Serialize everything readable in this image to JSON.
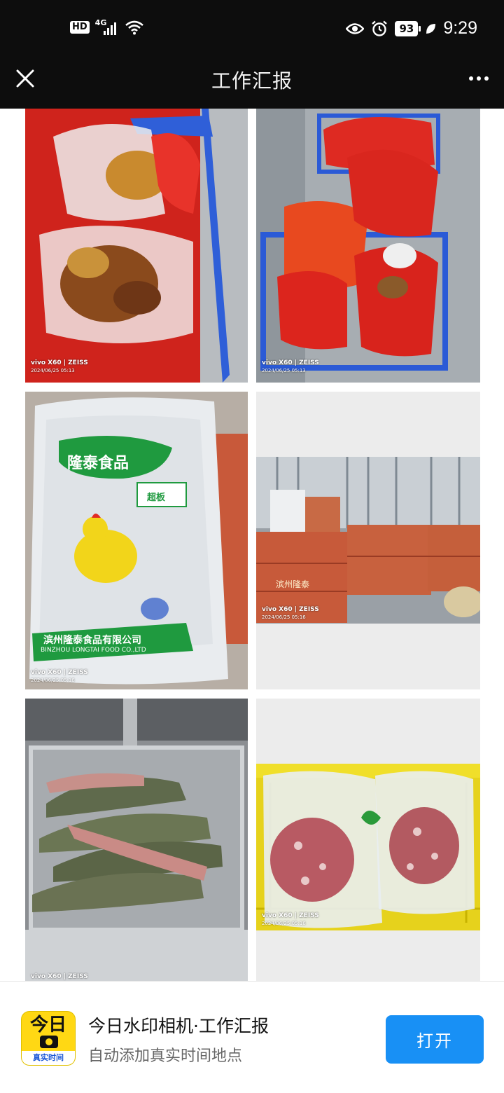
{
  "status_bar": {
    "hd": "HD",
    "network": "4G",
    "battery": "93",
    "time": "9:29"
  },
  "title_bar": {
    "title": "工作汇报"
  },
  "photos": [
    {
      "brand": "vivo X60 | ZEISS",
      "date": "2024/06/25 05:13"
    },
    {
      "brand": "vivo X60 | ZEISS",
      "date": "2024/06/25 05:13"
    },
    {
      "brand": "vivo X60 | ZEISS",
      "date": "2024/06/25 05:16",
      "package_brand": "隆泰食品",
      "package_tag": "超板",
      "package_company": "滨州隆泰食品有限公司",
      "package_company_en": "BINZHOU LONGTAI FOOD CO.,LTD"
    },
    {
      "brand": "vivo X60 | ZEISS",
      "date": "2024/06/25 05:16",
      "box_label": "滨州隆泰"
    },
    {
      "brand": "vivo X60 | ZEISS",
      "date": ""
    },
    {
      "brand": "vivo X60 | ZEISS",
      "date": "2024/06/25 05:16"
    }
  ],
  "promo": {
    "app_icon_top": "今日",
    "app_icon_tag": "真实时间",
    "title": "今日水印相机·工作汇报",
    "subtitle": "自动添加真实时间地点",
    "open_label": "打开"
  }
}
